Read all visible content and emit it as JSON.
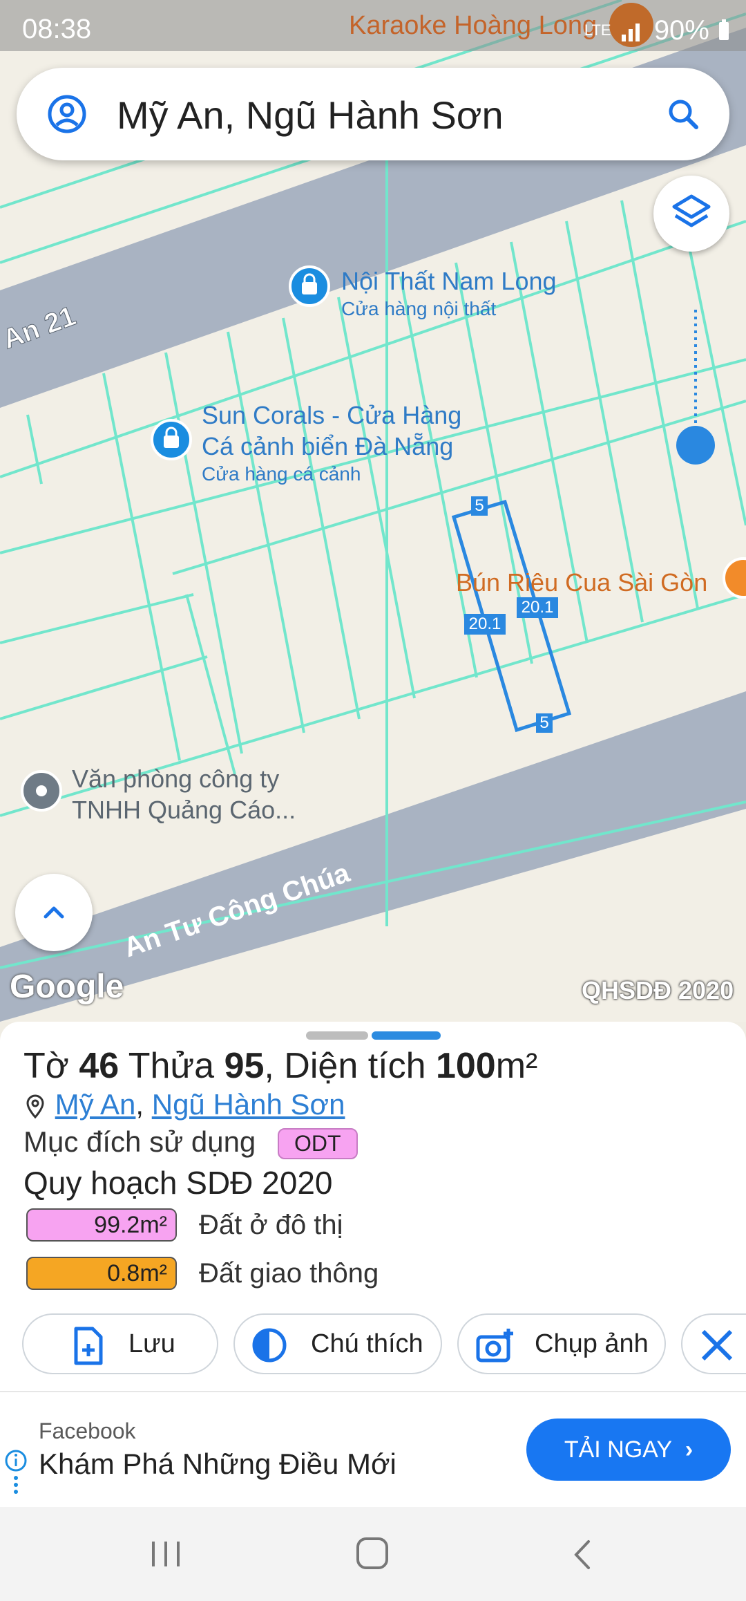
{
  "status_bar": {
    "time": "08:38",
    "right_text": "90%",
    "overlay_text": "Karaoke Hoàng Long",
    "network": "LTE"
  },
  "search": {
    "query": "Mỹ An, Ngũ Hành Sơn"
  },
  "map": {
    "streets": [
      "An 21",
      "An Tư Công Chúa"
    ],
    "pois": [
      {
        "name": "Nội Thất Nam Long",
        "category": "Cửa hàng nội thất",
        "icon": "shopping-bag-icon"
      },
      {
        "name_line1": "Sun Corals - Cửa Hàng",
        "name_line2": "Cá cảnh biển Đà Nẵng",
        "category": "Cửa hàng cá cảnh",
        "icon": "shopping-bag-icon"
      },
      {
        "name": "Bún Riêu Cua Sài Gòn",
        "icon": "restaurant-icon"
      },
      {
        "name_line1": "Văn phòng công ty",
        "name_line2": "TNHH Quảng Cáo...",
        "icon": "place-icon"
      }
    ],
    "parcel_dims": {
      "top": "5",
      "bottom": "5",
      "left": "20.1",
      "right": "20.1"
    },
    "google_logo": "Google",
    "plan_label": "QHSDĐ 2020",
    "colors": {
      "parcel_line": "#2a88e0",
      "lot_line": "#72e6cc",
      "road": "#a9b3c2"
    }
  },
  "sheet": {
    "title": {
      "sheet_label": "Tờ",
      "sheet_no": "46",
      "plot_label": "Thửa",
      "plot_no": "95",
      "area_label": ", Diện tích",
      "area": "100",
      "unit": "m²"
    },
    "ward": "Mỹ An",
    "district": "Ngũ Hành Sơn",
    "purpose_label": "Mục đích sử dụng",
    "purpose_code": "ODT",
    "plan_title": "Quy hoạch SDĐ 2020",
    "land_use": [
      {
        "value": "99.2m²",
        "label": "Đất ở đô thị",
        "color": "#f7a3f1"
      },
      {
        "value": "0.8m²",
        "label": "Đất giao thông",
        "color": "#f5a623"
      }
    ],
    "actions": [
      {
        "label": "Lưu",
        "icon": "file-add-icon"
      },
      {
        "label": "Chú thích",
        "icon": "contrast-icon"
      },
      {
        "label": "Chụp ảnh",
        "icon": "camera-add-icon"
      }
    ]
  },
  "ad": {
    "source": "Facebook",
    "headline": "Khám Phá Những Điều Mới",
    "cta": "TẢI NGAY"
  }
}
